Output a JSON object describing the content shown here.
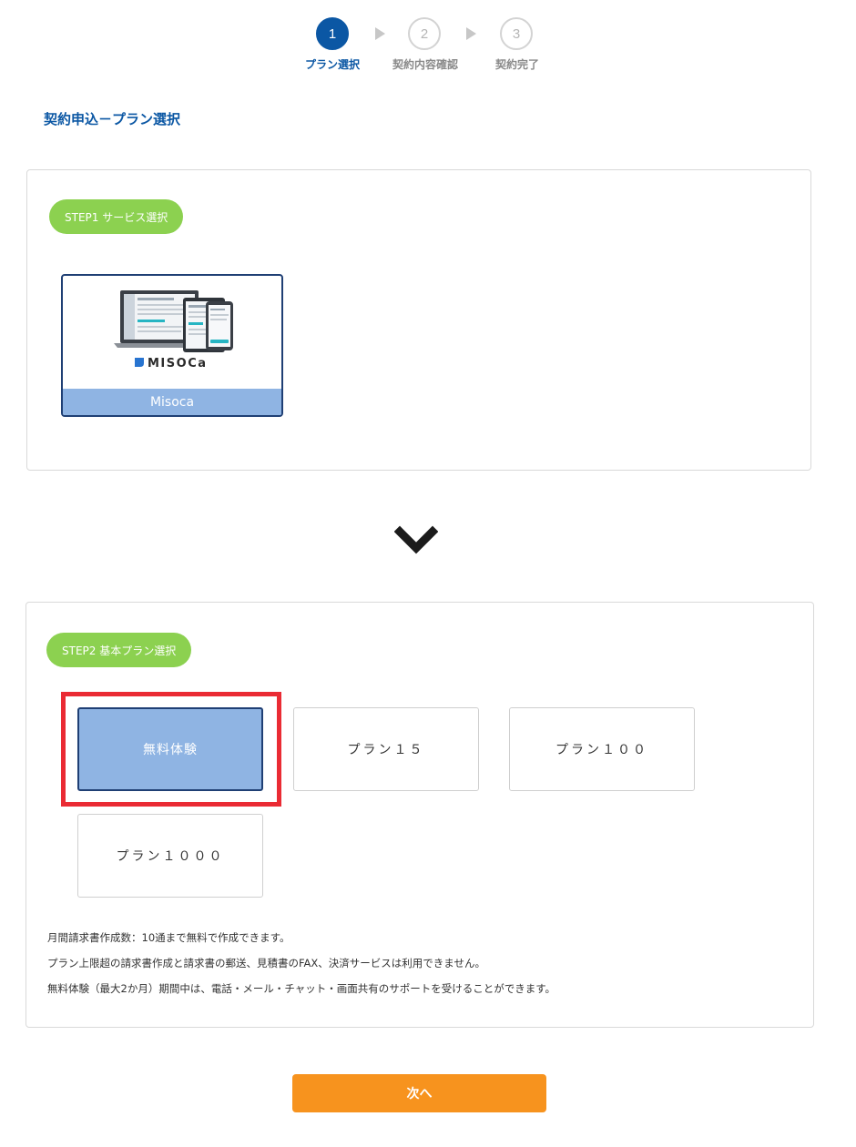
{
  "stepper": {
    "steps": [
      {
        "number": "1",
        "label": "プラン選択"
      },
      {
        "number": "2",
        "label": "契約内容確認"
      },
      {
        "number": "3",
        "label": "契約完了"
      }
    ]
  },
  "page": {
    "title": "契約申込－プラン選択"
  },
  "step1": {
    "badge": "STEP1 サービス選択",
    "service": {
      "logo_text": "MISOCa",
      "name": "Misoca"
    }
  },
  "step2": {
    "badge": "STEP2 基本プラン選択",
    "plans": [
      {
        "label": "無料体験",
        "selected": true
      },
      {
        "label": "プラン１５",
        "selected": false
      },
      {
        "label": "プラン１００",
        "selected": false
      },
      {
        "label": "プラン１０００",
        "selected": false
      }
    ],
    "notes": [
      "月間請求書作成数：10通まで無料で作成できます。",
      "プラン上限超の請求書作成と請求書の郵送、見積書のFAX、決済サービスは利用できません。",
      "無料体験（最大2か月）期間中は、電話・メール・チャット・画面共有のサポートを受けることができます。"
    ]
  },
  "actions": {
    "next_label": "次へ"
  },
  "colors": {
    "primary": "#0b57a4",
    "badge_green": "#8cd150",
    "selected_blue": "#8fb4e3",
    "highlight_red": "#ea2b34",
    "next_orange": "#f7931e"
  }
}
